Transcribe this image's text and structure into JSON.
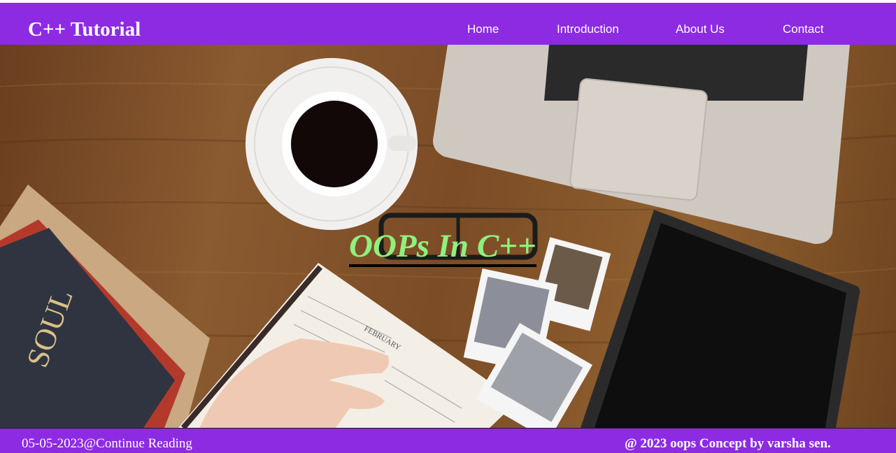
{
  "header": {
    "brand": "C++ Tutorial",
    "nav": [
      {
        "label": "Home"
      },
      {
        "label": "Introduction"
      },
      {
        "label": "About Us"
      },
      {
        "label": "Contact"
      }
    ]
  },
  "hero": {
    "title": "OOPs In C++",
    "book_cover_text": "SOUL",
    "notebook_month": "FEBRUARY"
  },
  "footer": {
    "left_text": "05-05-2023@Continue Reading",
    "right_text": "@ 2023 oops Concept by varsha sen."
  },
  "colors": {
    "brand_purple": "#8c2be2",
    "hero_title_green": "#8ff07e",
    "text_white": "#ffffff"
  }
}
